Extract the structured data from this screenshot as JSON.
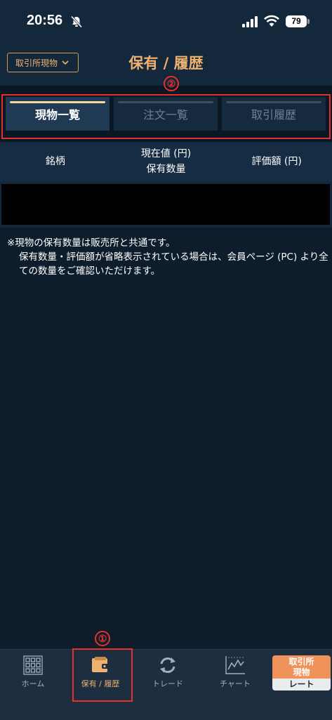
{
  "status": {
    "time": "20:56",
    "battery": "79"
  },
  "header": {
    "market_label": "取引所現物",
    "title": "保有 / 履歴"
  },
  "tabs": [
    {
      "label": "現物一覧",
      "active": true
    },
    {
      "label": "注文一覧",
      "active": false
    },
    {
      "label": "取引履歴",
      "active": false
    }
  ],
  "table": {
    "columns": [
      {
        "line1": "銘柄",
        "line2": ""
      },
      {
        "line1": "現在値 (円)",
        "line2": "保有数量"
      },
      {
        "line1": "評価額 (円)",
        "line2": ""
      }
    ]
  },
  "note": {
    "line1": "※現物の保有数量は販売所と共通です。",
    "line2": "保有数量・評価額が省略表示されている場合は、会員ページ (PC) より全ての数量をご確認いただけます。"
  },
  "annotations": {
    "tabs_number": "②",
    "nav_number": "①"
  },
  "nav": {
    "items": [
      {
        "label": "ホーム"
      },
      {
        "label": "保有 / 履歴"
      },
      {
        "label": "トレード"
      },
      {
        "label": "チャート"
      }
    ],
    "rate_top": "取引所\n現物",
    "rate_bottom": "レート"
  },
  "colors": {
    "accent": "#f0b070",
    "annotation": "#e8302a",
    "background": "#0e1d2b"
  }
}
